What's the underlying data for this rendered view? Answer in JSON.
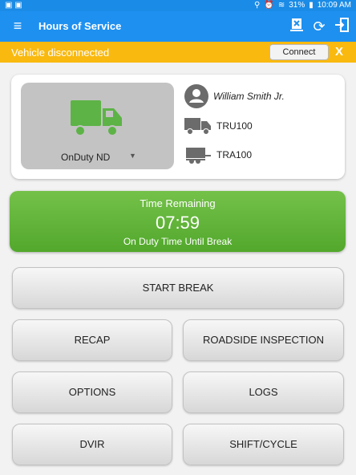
{
  "status_bar": {
    "battery": "31%",
    "time": "10:09 AM"
  },
  "appbar": {
    "title": "Hours of Service"
  },
  "alert": {
    "message": "Vehicle disconnected",
    "connect_label": "Connect",
    "close_label": "X"
  },
  "vehicle_card": {
    "duty_status": "OnDuty ND",
    "driver_name": "William Smith Jr.",
    "truck": "TRU100",
    "trailer": "TRA100"
  },
  "timer": {
    "title": "Time Remaining",
    "value": "07:59",
    "subtitle": "On Duty Time Until Break"
  },
  "buttons": {
    "start_break": "START BREAK",
    "recap": "RECAP",
    "roadside_inspection": "ROADSIDE INSPECTION",
    "options": "OPTIONS",
    "logs": "LOGS",
    "dvir": "DVIR",
    "shift_cycle": "SHIFT/CYCLE"
  },
  "colors": {
    "appbar": "#1e90f0",
    "alert": "#f9b90f",
    "timer": "#5db236",
    "truck_icon": "#5db346"
  },
  "icons": {
    "menu": "menu-icon",
    "export": "export-icon",
    "refresh": "refresh-icon",
    "logout": "logout-icon",
    "truck": "truck-icon",
    "driver": "person-icon",
    "trailer": "trailer-icon"
  }
}
